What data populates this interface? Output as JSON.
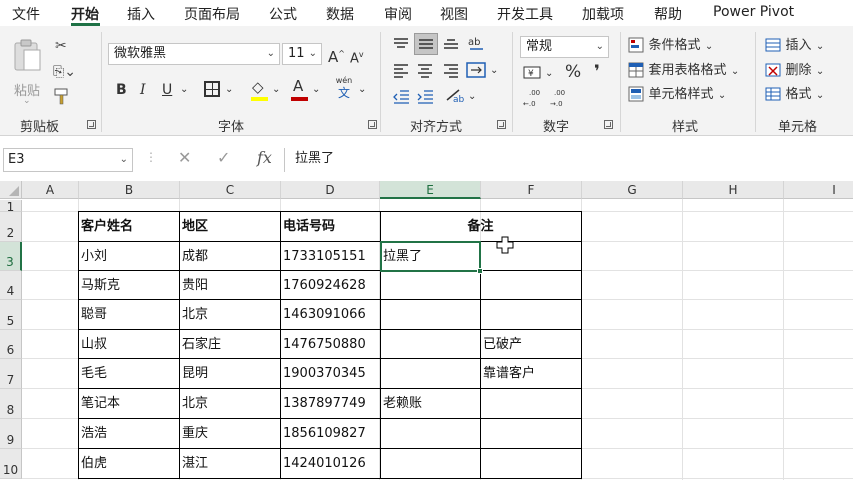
{
  "tabs": [
    "文件",
    "开始",
    "插入",
    "页面布局",
    "公式",
    "数据",
    "审阅",
    "视图",
    "开发工具",
    "加载项",
    "帮助",
    "Power Pivot"
  ],
  "ribbon": {
    "clipboard": {
      "paste": "粘贴",
      "label": "剪贴板"
    },
    "font": {
      "name": "微软雅黑",
      "size": "11",
      "bold": "B",
      "italic": "I",
      "underline": "U",
      "label": "字体",
      "grow": "A",
      "shrink": "A",
      "wen": "wén",
      "wen_char": "文"
    },
    "alignment": {
      "label": "对齐方式"
    },
    "number": {
      "format": "常规",
      "percent": "%",
      "comma": "❜",
      "label": "数字"
    },
    "styles": {
      "conditional": "条件格式",
      "table": "套用表格格式",
      "cell": "单元格样式",
      "label": "样式"
    },
    "cells": {
      "insert": "插入",
      "delete": "删除",
      "format": "格式",
      "label": "单元格"
    }
  },
  "formula_bar": {
    "name_box": "E3",
    "fx": "fx",
    "content": "拉黑了"
  },
  "columns": [
    "A",
    "B",
    "C",
    "D",
    "E",
    "F",
    "G",
    "H",
    "I"
  ],
  "rows": [
    "1",
    "2",
    "3",
    "4",
    "5",
    "6",
    "7",
    "8",
    "9",
    "10"
  ],
  "table": {
    "headers": [
      "客户姓名",
      "地区",
      "电话号码",
      "备注"
    ],
    "rows": [
      [
        "小刘",
        "成都",
        "1733105151",
        "拉黑了",
        ""
      ],
      [
        "马斯克",
        "贵阳",
        "1760924628",
        "",
        ""
      ],
      [
        "聪哥",
        "北京",
        "1463091066",
        "",
        ""
      ],
      [
        "山叔",
        "石家庄",
        "1476750880",
        "",
        "已破产"
      ],
      [
        "毛毛",
        "昆明",
        "1900370345",
        "",
        "靠谱客户"
      ],
      [
        "笔记本",
        "北京",
        "1387897749",
        "老赖账",
        ""
      ],
      [
        "浩浩",
        "重庆",
        "1856109827",
        "",
        ""
      ],
      [
        "伯虎",
        "湛江",
        "1424010126",
        "",
        ""
      ]
    ]
  },
  "colors": {
    "accent": "#217346",
    "font_color_bar": "#c00000",
    "fill_bar": "#ffff00"
  }
}
